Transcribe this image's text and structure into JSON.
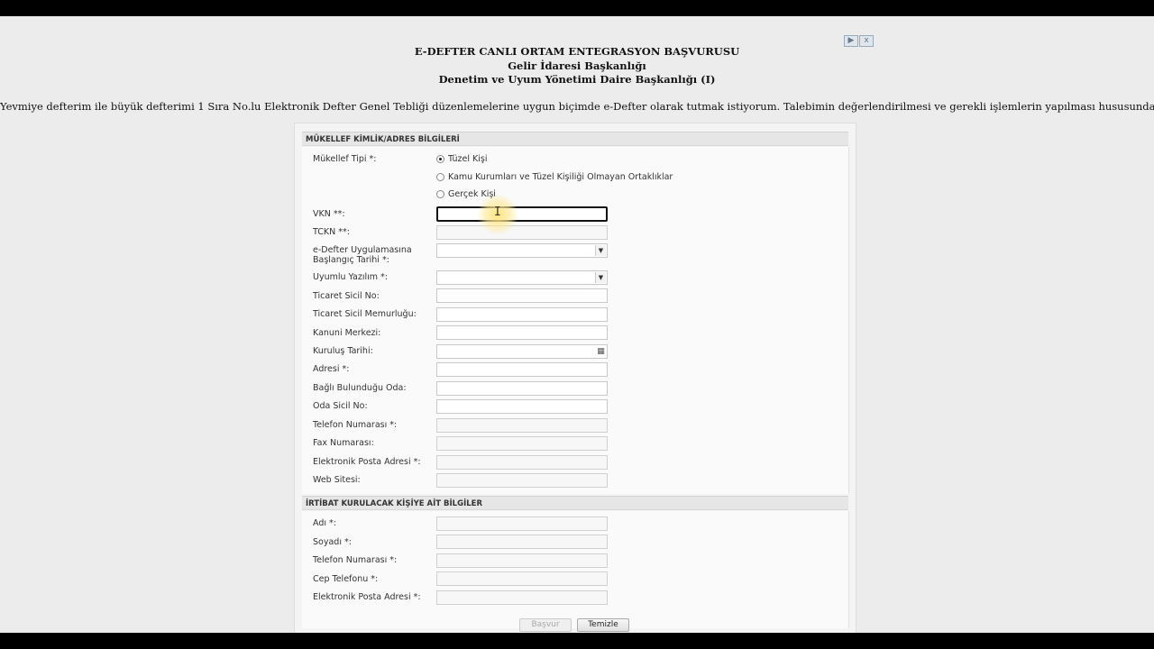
{
  "header": {
    "line1": "E-DEFTER CANLI ORTAM ENTEGRASYON BAŞVURUSU",
    "line2": "Gelir İdaresi Başkanlığı",
    "line3": "Denetim ve Uyum Yönetimi Daire Başkanlığı (I)"
  },
  "intro": "Yevmiye defterim ile büyük defterimi 1 Sıra No.lu Elektronik Defter Genel Tebliği düzenlemelerine uygun biçimde e-Defter olarak tutmak istiyorum. Talebimin değerlendirilmesi ve gerekli işlemlerin yapılması hususunda gereğini arz ederim.",
  "ad_icons": {
    "play": "▶",
    "close": "x"
  },
  "section1": {
    "title": "MÜKELLEF KİMLİK/ADRES BİLGİLERİ",
    "mukellef_tipi_label": "Mükellef Tipi *:",
    "radios": [
      {
        "label": "Tüzel Kişi",
        "selected": true
      },
      {
        "label": "Kamu Kurumları ve Tüzel Kişiliği Olmayan Ortaklıklar",
        "selected": false
      },
      {
        "label": "Gerçek Kişi",
        "selected": false
      }
    ],
    "fields": {
      "vkn": "VKN **:",
      "tckn": "TCKN **:",
      "baslangic_line1": "e-Defter Uygulamasına",
      "baslangic_line2": "Başlangıç Tarihi *:",
      "uyumlu_yazilim": "Uyumlu Yazılım *:",
      "ticaret_sicil_no": "Ticaret Sicil No:",
      "ticaret_sicil_memurlugu": "Ticaret Sicil Memurluğu:",
      "kanuni_merkezi": "Kanuni Merkezi:",
      "kurulus_tarihi": "Kuruluş Tarihi:",
      "adresi": "Adresi *:",
      "bagli_oda": "Bağlı Bulunduğu Oda:",
      "oda_sicil_no": "Oda Sicil No:",
      "telefon": "Telefon Numarası *:",
      "fax": "Fax Numarası:",
      "eposta": "Elektronik Posta Adresi *:",
      "web": "Web Sitesi:"
    }
  },
  "section2": {
    "title": "İRTİBAT KURULACAK KİŞİYE AİT BİLGİLER",
    "fields": {
      "adi": "Adı *:",
      "soyadi": "Soyadı *:",
      "telefon": "Telefon Numarası *:",
      "cep": "Cep Telefonu *:",
      "eposta": "Elektronik Posta Adresi *:"
    }
  },
  "buttons": {
    "basvur": "Başvur",
    "temizle": "Temizle"
  },
  "icons": {
    "select_arrow": "▼",
    "calendar": "▦",
    "text_cursor": "I"
  }
}
